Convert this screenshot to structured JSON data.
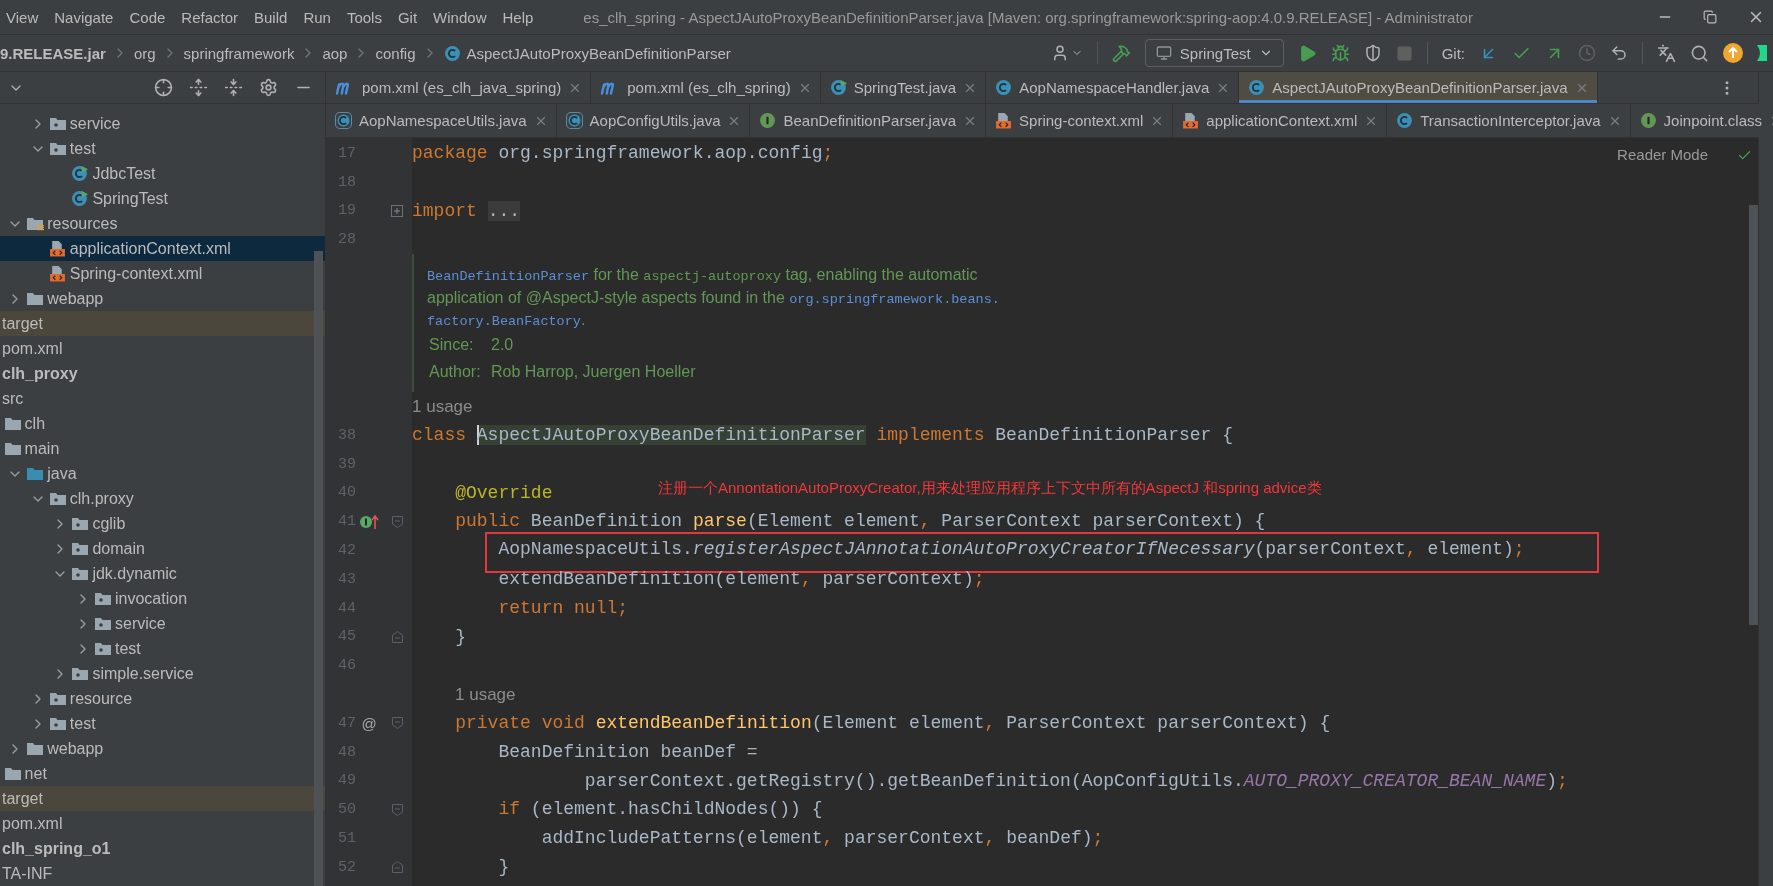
{
  "menu": [
    "View",
    "Navigate",
    "Code",
    "Refactor",
    "Build",
    "Run",
    "Tools",
    "Git",
    "Window",
    "Help"
  ],
  "window_title": "es_clh_spring - AspectJAutoProxyBeanDefinitionParser.java [Maven: org.springframework:spring-aop:4.0.9.RELEASE] - Administrator",
  "breadcrumb": [
    {
      "label": "9.RELEASE.jar",
      "kind": "jar"
    },
    {
      "label": "org",
      "kind": "package"
    },
    {
      "label": "springframework",
      "kind": "package"
    },
    {
      "label": "aop",
      "kind": "package"
    },
    {
      "label": "config",
      "kind": "package"
    },
    {
      "label": "AspectJAutoProxyBeanDefinitionParser",
      "kind": "class"
    }
  ],
  "toolbar": {
    "run_config": "SpringTest",
    "git_label": "Git:"
  },
  "project_tree": [
    {
      "children": [
        {
          "children": [
            {
              "children": [
                {
                  "label": "service",
                  "kind": "package",
                  "expanded": false,
                  "selected": false
                },
                {
                  "label": "test",
                  "kind": "package",
                  "expanded": true,
                  "selected": false,
                  "children": [
                    {
                      "label": "JdbcTest",
                      "kind": "test-class",
                      "selected": false
                    },
                    {
                      "label": "SpringTest",
                      "kind": "test-class",
                      "selected": false
                    }
                  ]
                }
              ]
            },
            {
              "label": "resources",
              "kind": "resources",
              "expanded": true,
              "selected": false,
              "children": [
                {
                  "label": "applicationContext.xml",
                  "kind": "xml",
                  "selected": true
                },
                {
                  "label": "Spring-context.xml",
                  "kind": "xml",
                  "selected": false
                }
              ]
            },
            {
              "label": "webapp",
              "kind": "folder",
              "expanded": false,
              "selected": false
            }
          ]
        }
      ]
    },
    {
      "label": "target",
      "kind": "excluded",
      "selected": false
    },
    {
      "label": "pom.xml",
      "kind": "cut",
      "selected": false
    },
    {
      "label": "clh_proxy",
      "kind": "module",
      "selected": false
    },
    {
      "label": "src",
      "kind": "cut",
      "selected": false,
      "children": [
        {
          "label": "clh",
          "kind": "folder",
          "selected": false
        },
        {
          "label": "main",
          "kind": "folder",
          "selected": false,
          "children": [
            {
              "label": "java",
              "kind": "source",
              "expanded": true,
              "selected": false,
              "children": [
                {
                  "label": "clh.proxy",
                  "kind": "package",
                  "expanded": true,
                  "selected": false,
                  "children": [
                    {
                      "label": "cglib",
                      "kind": "package",
                      "expanded": false,
                      "selected": false
                    },
                    {
                      "label": "domain",
                      "kind": "package",
                      "expanded": false,
                      "selected": false
                    },
                    {
                      "label": "jdk.dynamic",
                      "kind": "package",
                      "expanded": true,
                      "selected": false,
                      "children": [
                        {
                          "label": "invocation",
                          "kind": "package",
                          "expanded": false,
                          "selected": false
                        },
                        {
                          "label": "service",
                          "kind": "package",
                          "expanded": false,
                          "selected": false
                        },
                        {
                          "label": "test",
                          "kind": "package",
                          "expanded": false,
                          "selected": false
                        }
                      ]
                    },
                    {
                      "label": "simple.service",
                      "kind": "package",
                      "expanded": false,
                      "selected": false
                    }
                  ]
                },
                {
                  "label": "resource",
                  "kind": "package",
                  "expanded": false,
                  "selected": false
                },
                {
                  "label": "test",
                  "kind": "package",
                  "expanded": false,
                  "selected": false
                }
              ]
            },
            {
              "label": "webapp",
              "kind": "folder",
              "expanded": false,
              "selected": false
            }
          ]
        },
        {
          "label": "net",
          "kind": "folder",
          "selected": false
        }
      ]
    },
    {
      "label": "target",
      "kind": "excluded",
      "selected": false
    },
    {
      "label": "pom.xml",
      "kind": "cut",
      "selected": false
    },
    {
      "label": "clh_spring_o1",
      "kind": "module",
      "selected": false
    },
    {
      "label": "TA-INF",
      "kind": "cut",
      "selected": false
    }
  ],
  "tab_rows": [
    {
      "tabs": [
        {
          "label": "pom.xml (es_clh_java_spring)",
          "kind": "module-file",
          "selected": false
        },
        {
          "label": "pom.xml (es_clh_spring)",
          "kind": "module-file",
          "selected": false
        },
        {
          "label": "SpringTest.java",
          "kind": "test-class",
          "selected": false
        },
        {
          "label": "AopNamespaceHandler.java",
          "kind": "class",
          "selected": false
        },
        {
          "label": "AspectJAutoProxyBeanDefinitionParser.java",
          "kind": "class",
          "selected": true
        }
      ]
    },
    {
      "tabs": [
        {
          "label": "AopNamespaceUtils.java",
          "kind": "library-class",
          "selected": false
        },
        {
          "label": "AopConfigUtils.java",
          "kind": "library-class",
          "selected": false
        },
        {
          "label": "BeanDefinitionParser.java",
          "kind": "interface",
          "selected": false
        },
        {
          "label": "Spring-context.xml",
          "kind": "xml",
          "selected": false
        },
        {
          "label": "applicationContext.xml",
          "kind": "xml",
          "selected": false
        },
        {
          "label": "TransactionInterceptor.java",
          "kind": "class",
          "selected": false
        },
        {
          "label": "Joinpoint.class",
          "kind": "interface",
          "selected": false
        }
      ]
    }
  ],
  "reader_mode": "Reader Mode",
  "code": [
    {
      "kind": "code",
      "number": "17",
      "segments": [
        {
          "kind": "keyword",
          "text": "package"
        },
        {
          "kind": "plain",
          "text": " org.springframework.aop.config"
        },
        {
          "kind": "keyword",
          "text": ";"
        }
      ]
    },
    {
      "kind": "code",
      "number": "18"
    },
    {
      "kind": "code",
      "number": "19",
      "gutter": [
        {
          "kind": "fold-collapsed"
        }
      ],
      "segments": [
        {
          "kind": "keyword",
          "text": "import "
        },
        {
          "kind": "folded",
          "text": "..."
        }
      ]
    },
    {
      "kind": "code",
      "number": "28"
    },
    {
      "kind": "doc",
      "lines": [
        [
          {
            "kind": "link",
            "text": "BeanDefinitionParser"
          },
          {
            "kind": "text",
            "text": " for the "
          },
          {
            "kind": "code",
            "text": "aspectj-autoproxy"
          },
          {
            "kind": "text",
            "text": " tag, enabling the automatic"
          }
        ],
        [
          {
            "kind": "text",
            "text": "application of @AspectJ-style aspects found in the "
          },
          {
            "kind": "link",
            "text": "org.springframework.beans."
          }
        ],
        [
          {
            "kind": "link",
            "text": "factory.BeanFactory"
          },
          {
            "kind": "text",
            "text": "."
          }
        ]
      ],
      "fields": [
        {
          "label": "Since:",
          "value": "2.0"
        },
        {
          "label": "Author:",
          "value": "Rob Harrop, Juergen Hoeller"
        }
      ]
    },
    {
      "kind": "hint",
      "indented": false,
      "text": "1 usage"
    },
    {
      "kind": "code",
      "number": "38",
      "segments": [
        {
          "kind": "keyword",
          "text": "class "
        },
        {
          "kind": "highlight",
          "text": "AspectJAutoProxyBeanDefinitionParser"
        },
        {
          "kind": "keyword",
          "text": " implements "
        },
        {
          "kind": "plain",
          "text": "BeanDefinitionParser {"
        }
      ]
    },
    {
      "kind": "code",
      "number": "39"
    },
    {
      "kind": "code",
      "number": "40",
      "segments": [
        {
          "kind": "annotation",
          "text": "    @Override"
        }
      ],
      "note": "注册一个AnnontationAutoProxyCreator,用来处理应用程序上下文中所有的AspectJ 和spring advice类"
    },
    {
      "kind": "code",
      "number": "41",
      "gutter": [
        {
          "kind": "overrides"
        },
        {
          "kind": "fold-start"
        }
      ],
      "segments": [
        {
          "kind": "keyword",
          "text": "    public "
        },
        {
          "kind": "plain",
          "text": "BeanDefinition "
        },
        {
          "kind": "declaration",
          "text": "parse"
        },
        {
          "kind": "plain",
          "text": "(Element element"
        },
        {
          "kind": "keyword",
          "text": ", "
        },
        {
          "kind": "plain",
          "text": "ParserContext parserContext) {"
        }
      ]
    },
    {
      "kind": "boxed",
      "number": "42",
      "segments": [
        {
          "kind": "plain",
          "text": "        AopNamespaceUtils."
        },
        {
          "kind": "static-call",
          "text": "registerAspectJAnnotationAutoProxyCreatorIfNecessary"
        },
        {
          "kind": "plain",
          "text": "(parserContext"
        },
        {
          "kind": "keyword",
          "text": ", "
        },
        {
          "kind": "plain",
          "text": "element)"
        },
        {
          "kind": "keyword",
          "text": ";"
        }
      ]
    },
    {
      "kind": "code",
      "number": "43",
      "segments": [
        {
          "kind": "plain",
          "text": "        extendBeanDefinition(element"
        },
        {
          "kind": "keyword",
          "text": ", "
        },
        {
          "kind": "plain",
          "text": "parserContext)"
        },
        {
          "kind": "keyword",
          "text": ";"
        }
      ]
    },
    {
      "kind": "code",
      "number": "44",
      "segments": [
        {
          "kind": "keyword",
          "text": "        return null;"
        }
      ]
    },
    {
      "kind": "code",
      "number": "45",
      "gutter": [
        {
          "kind": "fold-end"
        }
      ],
      "segments": [
        {
          "kind": "plain",
          "text": "    }"
        }
      ]
    },
    {
      "kind": "code",
      "number": "46"
    },
    {
      "kind": "hint",
      "indented": true,
      "text": "1 usage"
    },
    {
      "kind": "code",
      "number": "47",
      "gutter": [
        {
          "kind": "mark",
          "text": "@"
        },
        {
          "kind": "fold-start"
        }
      ],
      "segments": [
        {
          "kind": "keyword",
          "text": "    private void "
        },
        {
          "kind": "declaration",
          "text": "extendBeanDefinition"
        },
        {
          "kind": "plain",
          "text": "(Element element"
        },
        {
          "kind": "keyword",
          "text": ", "
        },
        {
          "kind": "plain",
          "text": "ParserContext parserContext) {"
        }
      ]
    },
    {
      "kind": "code",
      "number": "48",
      "segments": [
        {
          "kind": "plain",
          "text": "        BeanDefinition beanDef ="
        }
      ]
    },
    {
      "kind": "code",
      "number": "49",
      "segments": [
        {
          "kind": "plain",
          "text": "                parserContext.getRegistry().getBeanDefinition(AopConfigUtils."
        },
        {
          "kind": "constant",
          "text": "AUTO_PROXY_CREATOR_BEAN_NAME"
        },
        {
          "kind": "plain",
          "text": ")"
        },
        {
          "kind": "keyword",
          "text": ";"
        }
      ]
    },
    {
      "kind": "code",
      "number": "50",
      "gutter": [
        {
          "kind": "fold-start"
        }
      ],
      "segments": [
        {
          "kind": "keyword",
          "text": "        if "
        },
        {
          "kind": "plain",
          "text": "(element.hasChildNodes()) {"
        }
      ]
    },
    {
      "kind": "code",
      "number": "51",
      "segments": [
        {
          "kind": "plain",
          "text": "            addIncludePatterns(element"
        },
        {
          "kind": "keyword",
          "text": ", "
        },
        {
          "kind": "plain",
          "text": "parserContext"
        },
        {
          "kind": "keyword",
          "text": ", "
        },
        {
          "kind": "plain",
          "text": "beanDef)"
        },
        {
          "kind": "keyword",
          "text": ";"
        }
      ]
    },
    {
      "kind": "code",
      "number": "52",
      "gutter": [
        {
          "kind": "fold-end"
        }
      ],
      "segments": [
        {
          "kind": "plain",
          "text": "        }"
        }
      ]
    }
  ]
}
